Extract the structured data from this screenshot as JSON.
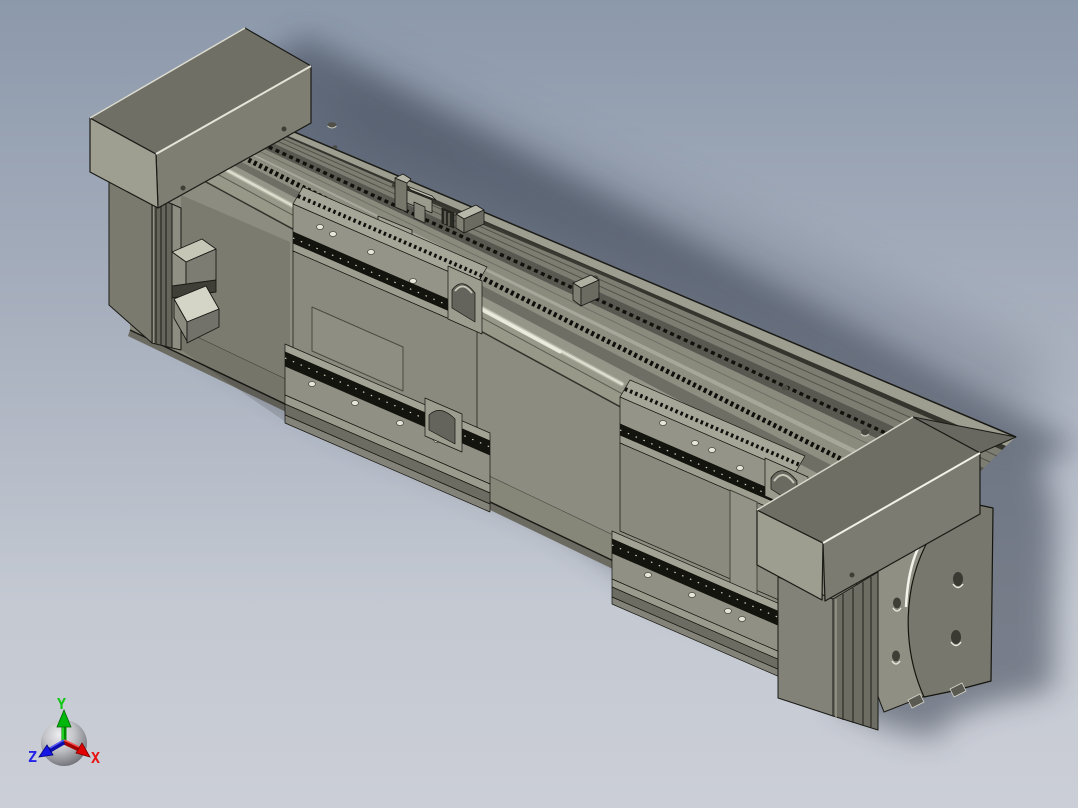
{
  "viewport": {
    "kind": "cad-3d-viewport",
    "background_top_color": "#8c99ab",
    "background_bottom_color": "#cbced6",
    "shadow_color": "#39404f"
  },
  "model": {
    "description": "Olive-gray motorized linear actuator / guide rail assembly shown in isometric view, running diagonally from upper-left to lower-right",
    "body_color": "#8c8c80",
    "top_face_color": "#6f6f65",
    "light_edge_color": "#a7a799",
    "rail_groove_color": "#13130f",
    "outline_color": "#1b1b16",
    "parts": [
      {
        "name": "motor-housing-cap",
        "position": "upper-left"
      },
      {
        "name": "motor-tower-column",
        "position": "left"
      },
      {
        "name": "sensor-blocks",
        "position": "left-column-base"
      },
      {
        "name": "guide-rail-deck",
        "position": "top"
      },
      {
        "name": "beam-front-face",
        "position": "center"
      },
      {
        "name": "carriage-block-1",
        "position": "center-left"
      },
      {
        "name": "carriage-block-2",
        "position": "center-right"
      },
      {
        "name": "end-block-cap",
        "position": "right"
      },
      {
        "name": "end-support-leg",
        "position": "lower-right"
      },
      {
        "name": "end-plate",
        "position": "far-right"
      }
    ]
  },
  "triad": {
    "name": "orientation-triad",
    "axes": [
      {
        "label": "X",
        "color": "#e81414",
        "direction": "lower-right"
      },
      {
        "label": "Y",
        "color": "#12c812",
        "direction": "up"
      },
      {
        "label": "Z",
        "color": "#2424e8",
        "direction": "lower-left"
      }
    ]
  }
}
